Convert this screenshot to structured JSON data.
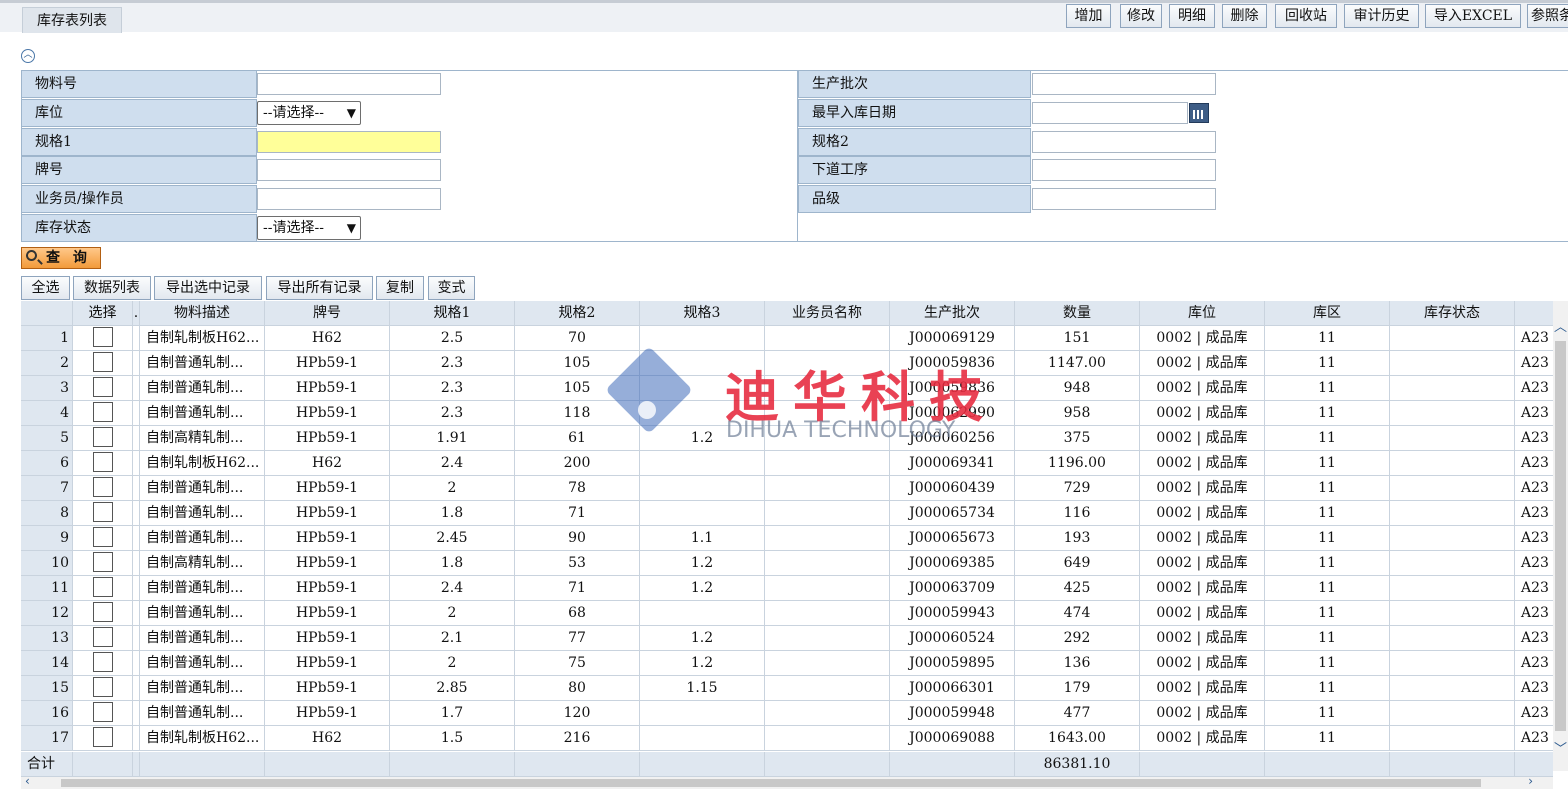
{
  "page": {
    "title": "库存表列表"
  },
  "toolbar": {
    "buttons": [
      "增加",
      "修改",
      "明细",
      "删除",
      "回收站",
      "审计历史",
      "导入EXCEL",
      "参照条"
    ]
  },
  "search": {
    "left": [
      {
        "label": "物料号",
        "type": "text",
        "value": ""
      },
      {
        "label": "库位",
        "type": "select",
        "value": "--请选择--"
      },
      {
        "label": "规格1",
        "type": "text",
        "value": ""
      },
      {
        "label": "牌号",
        "type": "text",
        "value": ""
      },
      {
        "label": "业务员/操作员",
        "type": "text",
        "value": ""
      },
      {
        "label": "库存状态",
        "type": "select",
        "value": "--请选择--"
      }
    ],
    "right": [
      {
        "label": "生产批次",
        "type": "text",
        "value": ""
      },
      {
        "label": "最早入库日期",
        "type": "date",
        "value": ""
      },
      {
        "label": "规格2",
        "type": "text",
        "value": ""
      },
      {
        "label": "下道工序",
        "type": "text",
        "value": ""
      },
      {
        "label": "品级",
        "type": "text",
        "value": ""
      }
    ],
    "query_label": "查 询"
  },
  "actions": [
    "全选",
    "数据列表",
    "导出选中记录",
    "导出所有记录",
    "复制",
    "变式"
  ],
  "table": {
    "columns": [
      "",
      "选择",
      ".",
      "物料描述",
      "牌号",
      "规格1",
      "规格2",
      "规格3",
      "业务员名称",
      "生产批次",
      "数量",
      "库位",
      "库区",
      "库存状态",
      ""
    ],
    "rows": [
      [
        "1",
        "自制轧制板H62...",
        "H62",
        "2.5",
        "70",
        "",
        "",
        "J000069129",
        "151",
        "0002 | 成品库",
        "11",
        "",
        "A23"
      ],
      [
        "2",
        "自制普通轧制...",
        "HPb59-1",
        "2.3",
        "105",
        "",
        "",
        "J000059836",
        "1147.00",
        "0002 | 成品库",
        "11",
        "",
        "A23"
      ],
      [
        "3",
        "自制普通轧制...",
        "HPb59-1",
        "2.3",
        "105",
        "",
        "",
        "J000059836",
        "948",
        "0002 | 成品库",
        "11",
        "",
        "A23"
      ],
      [
        "4",
        "自制普通轧制...",
        "HPb59-1",
        "2.3",
        "118",
        "",
        "",
        "J000062990",
        "958",
        "0002 | 成品库",
        "11",
        "",
        "A23"
      ],
      [
        "5",
        "自制高精轧制...",
        "HPb59-1",
        "1.91",
        "61",
        "1.2",
        "",
        "J000060256",
        "375",
        "0002 | 成品库",
        "11",
        "",
        "A23"
      ],
      [
        "6",
        "自制轧制板H62...",
        "H62",
        "2.4",
        "200",
        "",
        "",
        "J000069341",
        "1196.00",
        "0002 | 成品库",
        "11",
        "",
        "A23"
      ],
      [
        "7",
        "自制普通轧制...",
        "HPb59-1",
        "2",
        "78",
        "",
        "",
        "J000060439",
        "729",
        "0002 | 成品库",
        "11",
        "",
        "A23"
      ],
      [
        "8",
        "自制普通轧制...",
        "HPb59-1",
        "1.8",
        "71",
        "",
        "",
        "J000065734",
        "116",
        "0002 | 成品库",
        "11",
        "",
        "A23"
      ],
      [
        "9",
        "自制普通轧制...",
        "HPb59-1",
        "2.45",
        "90",
        "1.1",
        "",
        "J000065673",
        "193",
        "0002 | 成品库",
        "11",
        "",
        "A23"
      ],
      [
        "10",
        "自制高精轧制...",
        "HPb59-1",
        "1.8",
        "53",
        "1.2",
        "",
        "J000069385",
        "649",
        "0002 | 成品库",
        "11",
        "",
        "A23"
      ],
      [
        "11",
        "自制普通轧制...",
        "HPb59-1",
        "2.4",
        "71",
        "1.2",
        "",
        "J000063709",
        "425",
        "0002 | 成品库",
        "11",
        "",
        "A23"
      ],
      [
        "12",
        "自制普通轧制...",
        "HPb59-1",
        "2",
        "68",
        "",
        "",
        "J000059943",
        "474",
        "0002 | 成品库",
        "11",
        "",
        "A23"
      ],
      [
        "13",
        "自制普通轧制...",
        "HPb59-1",
        "2.1",
        "77",
        "1.2",
        "",
        "J000060524",
        "292",
        "0002 | 成品库",
        "11",
        "",
        "A23"
      ],
      [
        "14",
        "自制普通轧制...",
        "HPb59-1",
        "2",
        "75",
        "1.2",
        "",
        "J000059895",
        "136",
        "0002 | 成品库",
        "11",
        "",
        "A23"
      ],
      [
        "15",
        "自制普通轧制...",
        "HPb59-1",
        "2.85",
        "80",
        "1.15",
        "",
        "J000066301",
        "179",
        "0002 | 成品库",
        "11",
        "",
        "A23"
      ],
      [
        "16",
        "自制普通轧制...",
        "HPb59-1",
        "1.7",
        "120",
        "",
        "",
        "J000059948",
        "477",
        "0002 | 成品库",
        "11",
        "",
        "A23"
      ],
      [
        "17",
        "自制轧制板H62...",
        "H62",
        "1.5",
        "216",
        "",
        "",
        "J000069088",
        "1643.00",
        "0002 | 成品库",
        "11",
        "",
        "A23"
      ]
    ],
    "sum_label": "合计",
    "sum_qty": "86381.10"
  },
  "watermark": {
    "cn": "迪华科技",
    "en": "DIHUA TECHNOLOGY"
  }
}
